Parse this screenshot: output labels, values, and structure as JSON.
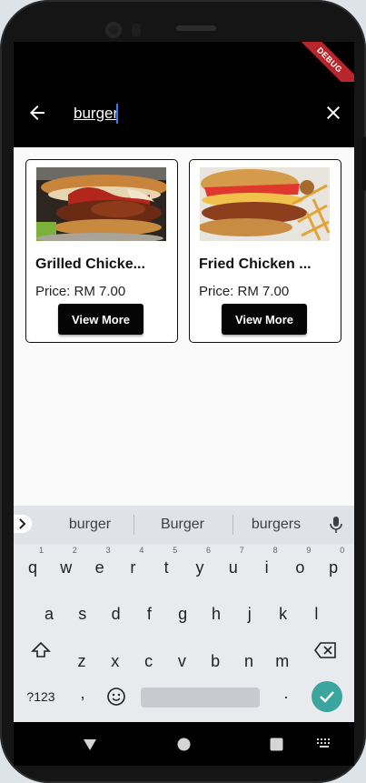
{
  "status_bar": {
    "debug_label": "DEBUG"
  },
  "app_bar": {
    "search_value": "burger",
    "back_icon": "arrow-back-icon",
    "clear_icon": "close-icon"
  },
  "products": [
    {
      "title": "Grilled Chicke...",
      "price": "Price: RM 7.00",
      "button": "View More"
    },
    {
      "title": "Fried Chicken ...",
      "price": "Price: RM 7.00",
      "button": "View More"
    }
  ],
  "keyboard": {
    "suggestions": [
      "burger",
      "Burger",
      "burgers"
    ],
    "row1": [
      "q",
      "w",
      "e",
      "r",
      "t",
      "y",
      "u",
      "i",
      "o",
      "p"
    ],
    "row1_hints": [
      "1",
      "2",
      "3",
      "4",
      "5",
      "6",
      "7",
      "8",
      "9",
      "0"
    ],
    "row2": [
      "a",
      "s",
      "d",
      "f",
      "g",
      "h",
      "j",
      "k",
      "l"
    ],
    "row3": [
      "z",
      "x",
      "c",
      "v",
      "b",
      "n",
      "m"
    ],
    "symbols_key": "?123",
    "comma_key": ",",
    "period_key": "."
  },
  "colors": {
    "app_bar": "#000000",
    "background": "#fafafa",
    "button": "#050505",
    "debug_ribbon": "#b7262a",
    "enter_key": "#3aa59c",
    "cursor": "#2f7cf6"
  }
}
